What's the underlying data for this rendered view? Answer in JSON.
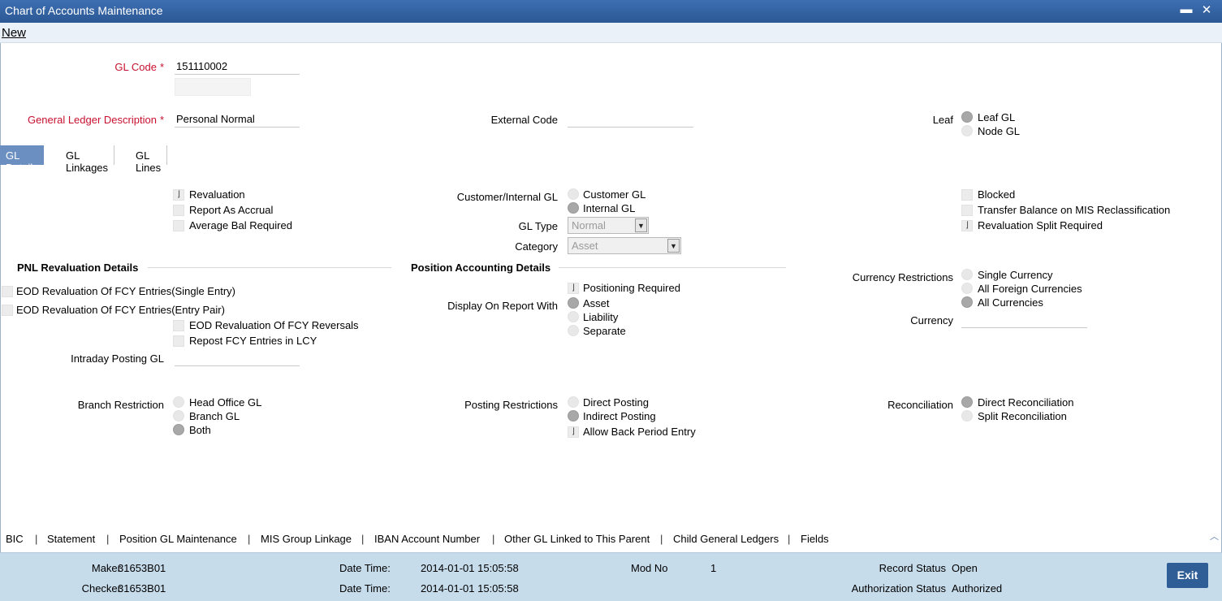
{
  "window": {
    "title": "Chart of Accounts Maintenance",
    "minimize": "▬",
    "close": "✕"
  },
  "menu": {
    "new": "New"
  },
  "header": {
    "gl_code_label": "GL Code",
    "gl_code_value": "151110002",
    "gl_desc_label": "General Ledger Description",
    "gl_desc_value": "Personal Normal",
    "external_code_label": "External Code",
    "external_code_value": "",
    "leaf_label": "Leaf",
    "leaf_options": [
      "Leaf GL",
      "Node GL"
    ],
    "required_mark": "*"
  },
  "tabs": [
    "GL Details",
    "GL Linkages",
    "GL Lines"
  ],
  "gl_details": {
    "checks_left": [
      "Revaluation",
      "Report As Accrual",
      "Average Bal Required"
    ],
    "customer_internal_label": "Customer/Internal GL",
    "customer_internal_options": [
      "Customer GL",
      "Internal GL"
    ],
    "gl_type_label": "GL Type",
    "gl_type_value": "Normal",
    "category_label": "Category",
    "category_value": "Asset",
    "checks_right": [
      "Blocked",
      "Transfer Balance on MIS Reclassification",
      "Revaluation Split Required"
    ],
    "pnl_title": "PNL Revaluation Details",
    "pnl_checks": [
      "EOD Revaluation Of FCY Entries(Single Entry)",
      "EOD Revaluation Of FCY Entries(Entry Pair)",
      "EOD Revaluation Of FCY Reversals",
      "Repost FCY Entries in LCY"
    ],
    "intraday_label": "Intraday Posting GL",
    "intraday_value": "",
    "position_title": "Position Accounting Details",
    "positioning_required": "Positioning Required",
    "display_on_report_label": "Display On Report With",
    "display_options": [
      "Asset",
      "Liability",
      "Separate"
    ],
    "currency_restrictions_label": "Currency Restrictions",
    "currency_options": [
      "Single Currency",
      "All Foreign Currencies",
      "All Currencies"
    ],
    "currency_label": "Currency",
    "currency_value": "",
    "branch_restriction_label": "Branch Restriction",
    "branch_options": [
      "Head Office GL",
      "Branch GL",
      "Both"
    ],
    "posting_restrictions_label": "Posting Restrictions",
    "posting_options": [
      "Direct Posting",
      "Indirect Posting"
    ],
    "allow_back_period": "Allow Back Period Entry",
    "reconciliation_label": "Reconciliation",
    "reconciliation_options": [
      "Direct Reconciliation",
      "Split Reconciliation"
    ],
    "check_mark": "⌋"
  },
  "bottom_links": [
    "BIC",
    "Statement",
    "Position GL Maintenance",
    "MIS Group Linkage",
    "IBAN Account Number",
    "Other GL Linked to This Parent",
    "Child General Ledgers",
    "Fields"
  ],
  "link_separator": "|",
  "scroll_up": "︿",
  "footer": {
    "maker_label": "Maker",
    "maker_value": "31653B01",
    "checker_label": "Checker",
    "checker_value": "31653B01",
    "date_time_label": "Date Time:",
    "maker_date": "2014-01-01 15:05:58",
    "checker_date": "2014-01-01 15:05:58",
    "mod_no_label": "Mod No",
    "mod_no_value": "1",
    "record_status_label": "Record Status",
    "record_status_value": "Open",
    "auth_status_label": "Authorization Status",
    "auth_status_value": "Authorized",
    "exit_label": "Exit"
  }
}
